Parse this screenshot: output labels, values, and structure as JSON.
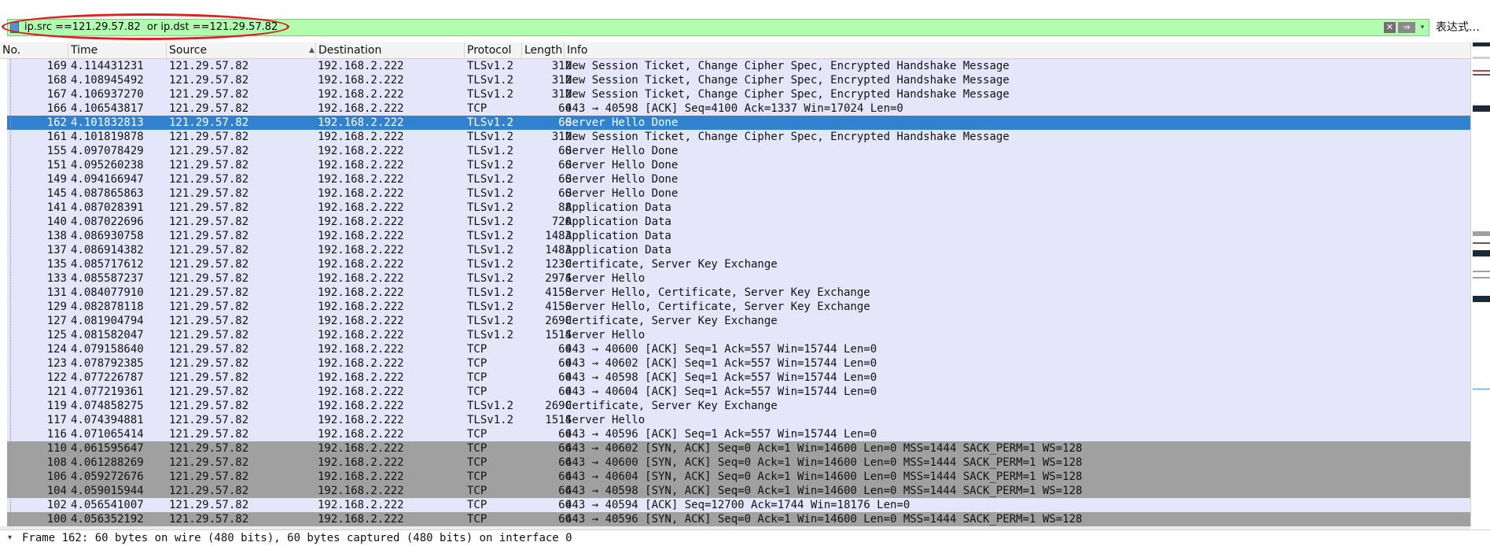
{
  "filter": {
    "value": "ip.src ==121.29.57.82  or ip.dst ==121.29.57.82",
    "clear_icon": "✕",
    "apply_icon": "⇒",
    "history_icon": "▾",
    "expression_label": "表达式…"
  },
  "columns": [
    "No.",
    "Time",
    "Source",
    "Destination",
    "Protocol",
    "Length",
    "Info"
  ],
  "sort_indicator": "▲",
  "packets": [
    {
      "no": "169",
      "time": "4.114431231",
      "src": "121.29.57.82",
      "dst": "192.168.2.222",
      "proto": "TLSv1.2",
      "len": "312",
      "info": "New Session Ticket, Change Cipher Spec, Encrypted Handshake Message",
      "style": "tls"
    },
    {
      "no": "168",
      "time": "4.108945492",
      "src": "121.29.57.82",
      "dst": "192.168.2.222",
      "proto": "TLSv1.2",
      "len": "312",
      "info": "New Session Ticket, Change Cipher Spec, Encrypted Handshake Message",
      "style": "tls"
    },
    {
      "no": "167",
      "time": "4.106937270",
      "src": "121.29.57.82",
      "dst": "192.168.2.222",
      "proto": "TLSv1.2",
      "len": "312",
      "info": "New Session Ticket, Change Cipher Spec, Encrypted Handshake Message",
      "style": "tls"
    },
    {
      "no": "166",
      "time": "4.106543817",
      "src": "121.29.57.82",
      "dst": "192.168.2.222",
      "proto": "TCP",
      "len": "60",
      "info": "443 → 40598 [ACK] Seq=4100 Ack=1337 Win=17024 Len=0",
      "style": "tls"
    },
    {
      "no": "162",
      "time": "4.101832813",
      "src": "121.29.57.82",
      "dst": "192.168.2.222",
      "proto": "TLSv1.2",
      "len": "60",
      "info": "Server Hello Done",
      "style": "sel"
    },
    {
      "no": "161",
      "time": "4.101819878",
      "src": "121.29.57.82",
      "dst": "192.168.2.222",
      "proto": "TLSv1.2",
      "len": "312",
      "info": "New Session Ticket, Change Cipher Spec, Encrypted Handshake Message",
      "style": "tls"
    },
    {
      "no": "155",
      "time": "4.097078429",
      "src": "121.29.57.82",
      "dst": "192.168.2.222",
      "proto": "TLSv1.2",
      "len": "60",
      "info": "Server Hello Done",
      "style": "tls"
    },
    {
      "no": "151",
      "time": "4.095260238",
      "src": "121.29.57.82",
      "dst": "192.168.2.222",
      "proto": "TLSv1.2",
      "len": "60",
      "info": "Server Hello Done",
      "style": "tls"
    },
    {
      "no": "149",
      "time": "4.094166947",
      "src": "121.29.57.82",
      "dst": "192.168.2.222",
      "proto": "TLSv1.2",
      "len": "60",
      "info": "Server Hello Done",
      "style": "tls"
    },
    {
      "no": "145",
      "time": "4.087865863",
      "src": "121.29.57.82",
      "dst": "192.168.2.222",
      "proto": "TLSv1.2",
      "len": "60",
      "info": "Server Hello Done",
      "style": "tls"
    },
    {
      "no": "141",
      "time": "4.087028391",
      "src": "121.29.57.82",
      "dst": "192.168.2.222",
      "proto": "TLSv1.2",
      "len": "88",
      "info": "Application Data",
      "style": "tls"
    },
    {
      "no": "140",
      "time": "4.087022696",
      "src": "121.29.57.82",
      "dst": "192.168.2.222",
      "proto": "TLSv1.2",
      "len": "720",
      "info": "Application Data",
      "style": "tls"
    },
    {
      "no": "138",
      "time": "4.086930758",
      "src": "121.29.57.82",
      "dst": "192.168.2.222",
      "proto": "TLSv1.2",
      "len": "1483",
      "info": "Application Data",
      "style": "tls"
    },
    {
      "no": "137",
      "time": "4.086914382",
      "src": "121.29.57.82",
      "dst": "192.168.2.222",
      "proto": "TLSv1.2",
      "len": "1483",
      "info": "Application Data",
      "style": "tls"
    },
    {
      "no": "135",
      "time": "4.085717612",
      "src": "121.29.57.82",
      "dst": "192.168.2.222",
      "proto": "TLSv1.2",
      "len": "1230",
      "info": "Certificate, Server Key Exchange",
      "style": "tls"
    },
    {
      "no": "133",
      "time": "4.085587237",
      "src": "121.29.57.82",
      "dst": "192.168.2.222",
      "proto": "TLSv1.2",
      "len": "2974",
      "info": "Server Hello",
      "style": "tls"
    },
    {
      "no": "131",
      "time": "4.084077910",
      "src": "121.29.57.82",
      "dst": "192.168.2.222",
      "proto": "TLSv1.2",
      "len": "4150",
      "info": "Server Hello, Certificate, Server Key Exchange",
      "style": "tls"
    },
    {
      "no": "129",
      "time": "4.082878118",
      "src": "121.29.57.82",
      "dst": "192.168.2.222",
      "proto": "TLSv1.2",
      "len": "4150",
      "info": "Server Hello, Certificate, Server Key Exchange",
      "style": "tls"
    },
    {
      "no": "127",
      "time": "4.081904794",
      "src": "121.29.57.82",
      "dst": "192.168.2.222",
      "proto": "TLSv1.2",
      "len": "2690",
      "info": "Certificate, Server Key Exchange",
      "style": "tls"
    },
    {
      "no": "125",
      "time": "4.081582047",
      "src": "121.29.57.82",
      "dst": "192.168.2.222",
      "proto": "TLSv1.2",
      "len": "1514",
      "info": "Server Hello",
      "style": "tls"
    },
    {
      "no": "124",
      "time": "4.079158640",
      "src": "121.29.57.82",
      "dst": "192.168.2.222",
      "proto": "TCP",
      "len": "60",
      "info": "443 → 40600 [ACK] Seq=1 Ack=557 Win=15744 Len=0",
      "style": "tls"
    },
    {
      "no": "123",
      "time": "4.078792385",
      "src": "121.29.57.82",
      "dst": "192.168.2.222",
      "proto": "TCP",
      "len": "60",
      "info": "443 → 40602 [ACK] Seq=1 Ack=557 Win=15744 Len=0",
      "style": "tls"
    },
    {
      "no": "122",
      "time": "4.077226787",
      "src": "121.29.57.82",
      "dst": "192.168.2.222",
      "proto": "TCP",
      "len": "60",
      "info": "443 → 40598 [ACK] Seq=1 Ack=557 Win=15744 Len=0",
      "style": "tls"
    },
    {
      "no": "121",
      "time": "4.077219361",
      "src": "121.29.57.82",
      "dst": "192.168.2.222",
      "proto": "TCP",
      "len": "60",
      "info": "443 → 40604 [ACK] Seq=1 Ack=557 Win=15744 Len=0",
      "style": "tls"
    },
    {
      "no": "119",
      "time": "4.074858275",
      "src": "121.29.57.82",
      "dst": "192.168.2.222",
      "proto": "TLSv1.2",
      "len": "2690",
      "info": "Certificate, Server Key Exchange",
      "style": "tls"
    },
    {
      "no": "117",
      "time": "4.074394881",
      "src": "121.29.57.82",
      "dst": "192.168.2.222",
      "proto": "TLSv1.2",
      "len": "1514",
      "info": "Server Hello",
      "style": "tls"
    },
    {
      "no": "116",
      "time": "4.071065414",
      "src": "121.29.57.82",
      "dst": "192.168.2.222",
      "proto": "TCP",
      "len": "60",
      "info": "443 → 40596 [ACK] Seq=1 Ack=557 Win=15744 Len=0",
      "style": "tls"
    },
    {
      "no": "110",
      "time": "4.061595647",
      "src": "121.29.57.82",
      "dst": "192.168.2.222",
      "proto": "TCP",
      "len": "66",
      "info": "443 → 40602 [SYN, ACK] Seq=0 Ack=1 Win=14600 Len=0 MSS=1444 SACK_PERM=1 WS=128",
      "style": "syn"
    },
    {
      "no": "108",
      "time": "4.061288269",
      "src": "121.29.57.82",
      "dst": "192.168.2.222",
      "proto": "TCP",
      "len": "66",
      "info": "443 → 40600 [SYN, ACK] Seq=0 Ack=1 Win=14600 Len=0 MSS=1444 SACK_PERM=1 WS=128",
      "style": "syn"
    },
    {
      "no": "106",
      "time": "4.059272676",
      "src": "121.29.57.82",
      "dst": "192.168.2.222",
      "proto": "TCP",
      "len": "66",
      "info": "443 → 40604 [SYN, ACK] Seq=0 Ack=1 Win=14600 Len=0 MSS=1444 SACK_PERM=1 WS=128",
      "style": "syn"
    },
    {
      "no": "104",
      "time": "4.059015944",
      "src": "121.29.57.82",
      "dst": "192.168.2.222",
      "proto": "TCP",
      "len": "66",
      "info": "443 → 40598 [SYN, ACK] Seq=0 Ack=1 Win=14600 Len=0 MSS=1444 SACK_PERM=1 WS=128",
      "style": "syn"
    },
    {
      "no": "102",
      "time": "4.056541007",
      "src": "121.29.57.82",
      "dst": "192.168.2.222",
      "proto": "TCP",
      "len": "60",
      "info": "443 → 40594 [ACK] Seq=12700 Ack=1744 Win=18176 Len=0",
      "style": "tls"
    },
    {
      "no": "100",
      "time": "4.056352192",
      "src": "121.29.57.82",
      "dst": "192.168.2.222",
      "proto": "TCP",
      "len": "66",
      "info": "443 → 40596 [SYN, ACK] Seq=0 Ack=1 Win=14600 Len=0 MSS=1444 SACK_PERM=1 WS=128",
      "style": "syn"
    }
  ],
  "detail": {
    "expander_icon": "▾",
    "text": "Frame 162: 60 bytes on wire (480 bits), 60 bytes captured (480 bits) on interface 0"
  },
  "colors": {
    "filter_valid": "#afffaf",
    "tls_row": "#e6e6fa",
    "syn_row": "#a0a0a0",
    "selected_row": "#3182ce",
    "annotation": "#e02020"
  }
}
